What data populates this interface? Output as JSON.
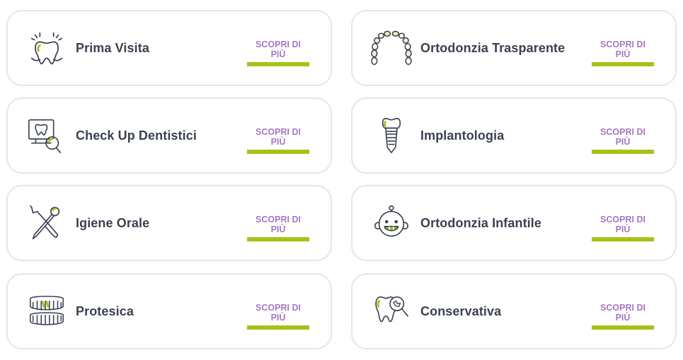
{
  "colors": {
    "accent_green": "#a6c218",
    "link_purple": "#a678c4",
    "title_text": "#3a4150",
    "card_border": "#e6e6e6"
  },
  "services": [
    {
      "title": "Prima Visita",
      "link_label": "SCOPRI DI PIÙ",
      "icon": "tooth-sparkle-icon"
    },
    {
      "title": "Ortodonzia Trasparente",
      "link_label": "SCOPRI DI PIÙ",
      "icon": "dental-aligner-icon"
    },
    {
      "title": "Check Up Dentistici",
      "link_label": "SCOPRI DI PIÙ",
      "icon": "monitor-tooth-magnifier-icon"
    },
    {
      "title": "Implantologia",
      "link_label": "SCOPRI DI PIÙ",
      "icon": "dental-implant-icon"
    },
    {
      "title": "Igiene Orale",
      "link_label": "SCOPRI DI PIÙ",
      "icon": "dental-tools-icon"
    },
    {
      "title": "Ortodonzia Infantile",
      "link_label": "SCOPRI DI PIÙ",
      "icon": "baby-face-icon"
    },
    {
      "title": "Protesica",
      "link_label": "SCOPRI DI PIÙ",
      "icon": "dentures-icon"
    },
    {
      "title": "Conservativa",
      "link_label": "SCOPRI DI PIÙ",
      "icon": "tooth-decay-magnifier-icon"
    }
  ]
}
